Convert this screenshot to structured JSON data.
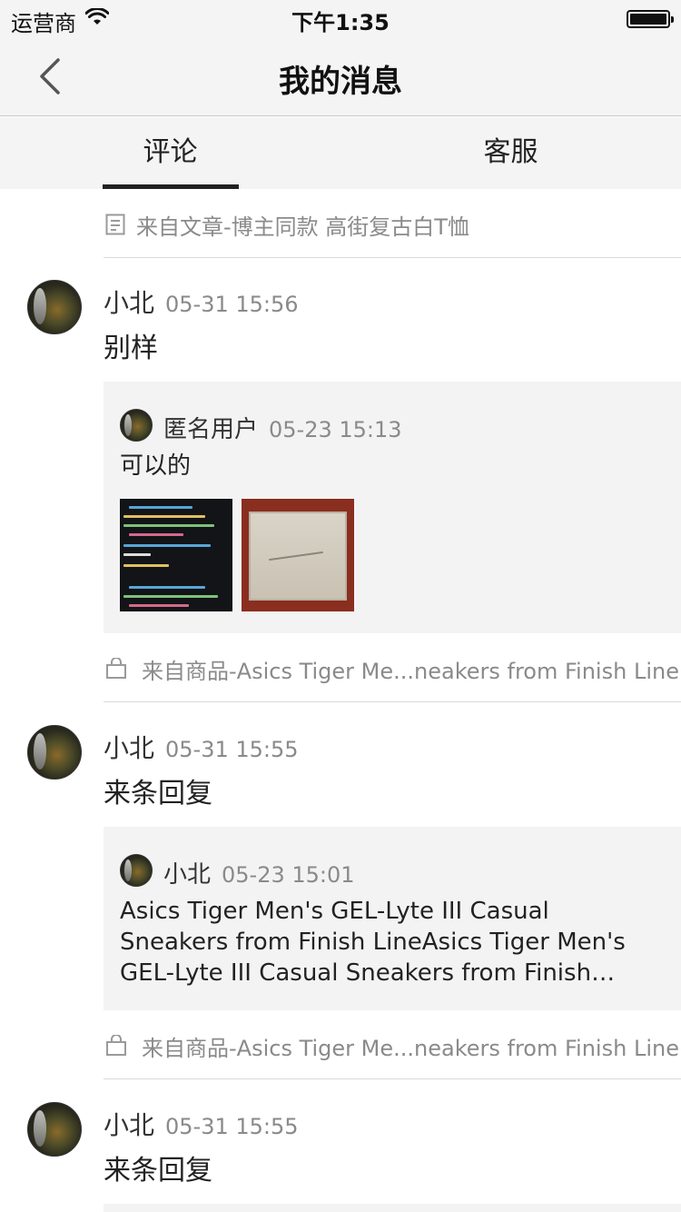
{
  "status_bar": {
    "carrier": "运营商",
    "time": "下午1:35"
  },
  "nav": {
    "title": "我的消息"
  },
  "tabs": [
    {
      "label": "评论",
      "active": true
    },
    {
      "label": "客服",
      "active": false
    }
  ],
  "feed": {
    "top_source": "来自文章-博主同款 高街复古白T恤",
    "comments": [
      {
        "name": "小北",
        "time": "05-31 15:56",
        "body": "别样",
        "quote": {
          "name": "匿名用户",
          "time": "05-23 15:13",
          "body": "可以的",
          "images": [
            "code-screenshot",
            "painting-photo"
          ]
        },
        "source": "来自商品-Asics Tiger Me...neakers from Finish Line"
      },
      {
        "name": "小北",
        "time": "05-31 15:55",
        "body": "来条回复",
        "quote": {
          "name": "小北",
          "time": "05-23 15:01",
          "body": "Asics Tiger Men's GEL-Lyte III Casual Sneakers from Finish LineAsics Tiger Men's GEL-Lyte III Casual Sneakers from Finish Lin…"
        },
        "source": "来自商品-Asics Tiger Me...neakers from Finish Line"
      },
      {
        "name": "小北",
        "time": "05-31 15:55",
        "body": "来条回复"
      }
    ]
  },
  "colors": {
    "nav_bg": "#f4f4f4",
    "quote_bg": "#f3f3f3",
    "muted_text": "#8a8a8a",
    "tab_indicator": "#222222"
  }
}
